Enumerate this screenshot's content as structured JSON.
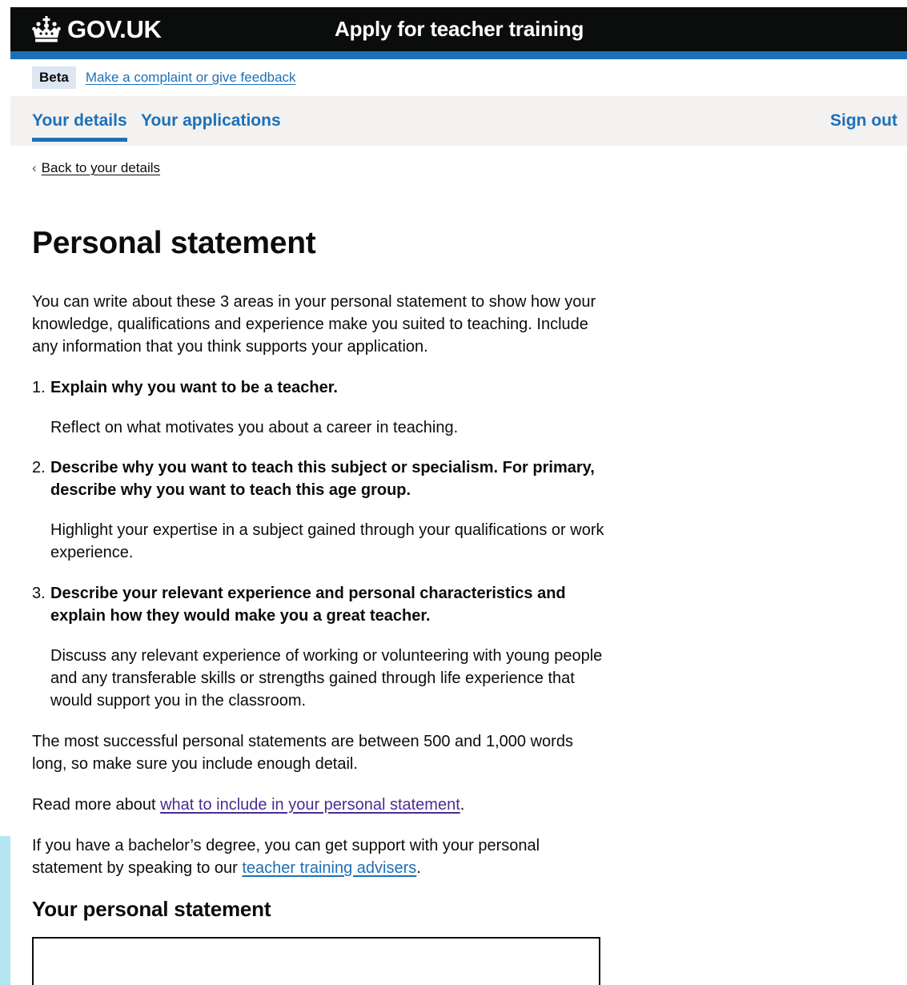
{
  "header": {
    "logo_text": "GOV.UK",
    "service_name": "Apply for teacher training"
  },
  "phase_banner": {
    "tag": "Beta",
    "feedback_link": "Make a complaint or give feedback"
  },
  "nav": {
    "items": [
      {
        "label": "Your details",
        "active": true
      },
      {
        "label": "Your applications",
        "active": false
      }
    ],
    "sign_out": "Sign out"
  },
  "back_link": "Back to your details",
  "page_title": "Personal statement",
  "intro": "You can write about these 3 areas in your personal statement to show how your knowledge, qualifications and experience make you suited to teaching. Include any information that you think supports your application.",
  "areas": [
    {
      "number": "1.",
      "heading": "Explain why you want to be a teacher.",
      "body": "Reflect on what motivates you about a career in teaching."
    },
    {
      "number": "2.",
      "heading": "Describe why you want to teach this subject or specialism. For primary, describe why you want to teach this age group.",
      "body": "Highlight your expertise in a subject gained through your qualifications or work experience."
    },
    {
      "number": "3.",
      "heading": "Describe your relevant experience and personal characteristics and explain how they would make you a great teacher.",
      "body": "Discuss any relevant experience of working or volunteering with young people and any transferable skills or strengths gained through life experience that would support you in the classroom."
    }
  ],
  "word_guidance": "The most successful personal statements are between 500 and 1,000 words long, so make sure you include enough detail.",
  "read_more": {
    "prefix": "Read more about ",
    "link": "what to include in your personal statement",
    "suffix": "."
  },
  "advisers": {
    "prefix": "If you have a bachelor’s degree, you can get support with your personal statement by speaking to our ",
    "link": "teacher training advisers",
    "suffix": "."
  },
  "statement_heading": "Your personal statement",
  "statement_value": "",
  "colors": {
    "header_bg": "#0b0c0c",
    "brand_blue": "#1d70b8",
    "visited_link": "#4c2c92",
    "nav_bg": "#f3f2f1",
    "tag_bg": "#dde7f2"
  }
}
